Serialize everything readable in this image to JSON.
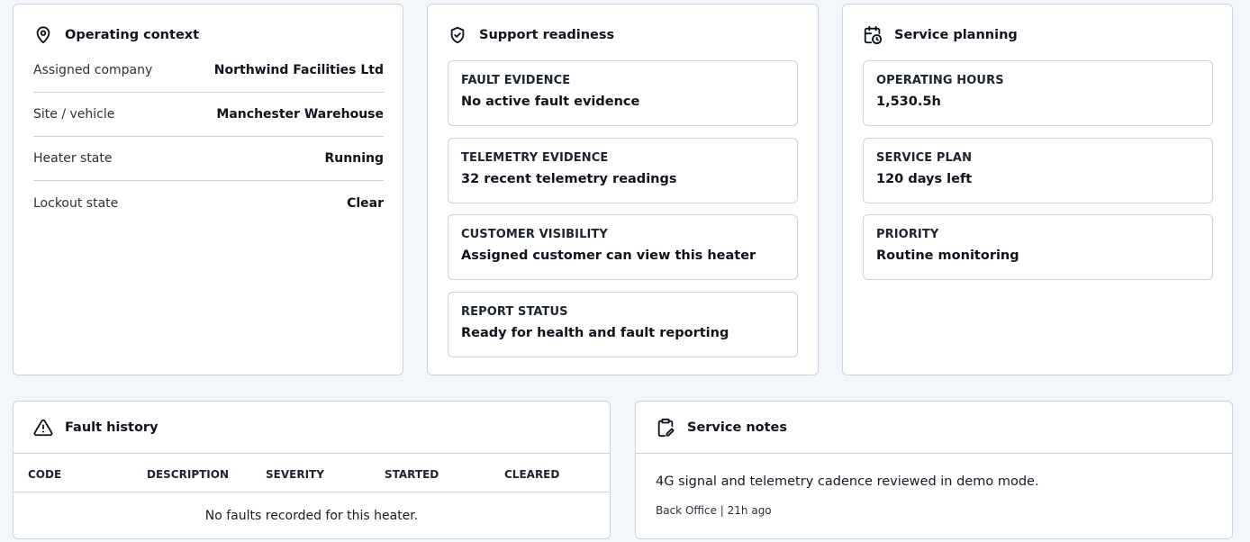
{
  "operating_context": {
    "title": "Operating context",
    "icon": "location-pin-icon",
    "rows": [
      {
        "label": "Assigned company",
        "value": "Northwind Facilities Ltd"
      },
      {
        "label": "Site / vehicle",
        "value": "Manchester Warehouse"
      },
      {
        "label": "Heater state",
        "value": "Running"
      },
      {
        "label": "Lockout state",
        "value": "Clear"
      }
    ]
  },
  "support_readiness": {
    "title": "Support readiness",
    "icon": "shield-check-icon",
    "tiles": [
      {
        "label": "FAULT EVIDENCE",
        "value": "No active fault evidence"
      },
      {
        "label": "TELEMETRY EVIDENCE",
        "value": "32 recent telemetry readings"
      },
      {
        "label": "CUSTOMER VISIBILITY",
        "value": "Assigned customer can view this heater"
      },
      {
        "label": "REPORT STATUS",
        "value": "Ready for health and fault reporting"
      }
    ]
  },
  "service_planning": {
    "title": "Service planning",
    "icon": "calendar-clock-icon",
    "tiles": [
      {
        "label": "OPERATING HOURS",
        "value": "1,530.5h"
      },
      {
        "label": "SERVICE PLAN",
        "value": "120 days left"
      },
      {
        "label": "PRIORITY",
        "value": "Routine monitoring"
      }
    ]
  },
  "fault_history": {
    "title": "Fault history",
    "icon": "warning-triangle-icon",
    "columns": [
      "CODE",
      "DESCRIPTION",
      "SEVERITY",
      "STARTED",
      "CLEARED"
    ],
    "empty_message": "No faults recorded for this heater."
  },
  "service_notes": {
    "title": "Service notes",
    "icon": "clipboard-edit-icon",
    "note": "4G signal and telemetry cadence reviewed in demo mode.",
    "meta": "Back Office | 21h ago"
  },
  "colors": {
    "border": "#c9d3df",
    "background": "#f3f6fa",
    "card": "#ffffff",
    "text": "#0e131c"
  }
}
